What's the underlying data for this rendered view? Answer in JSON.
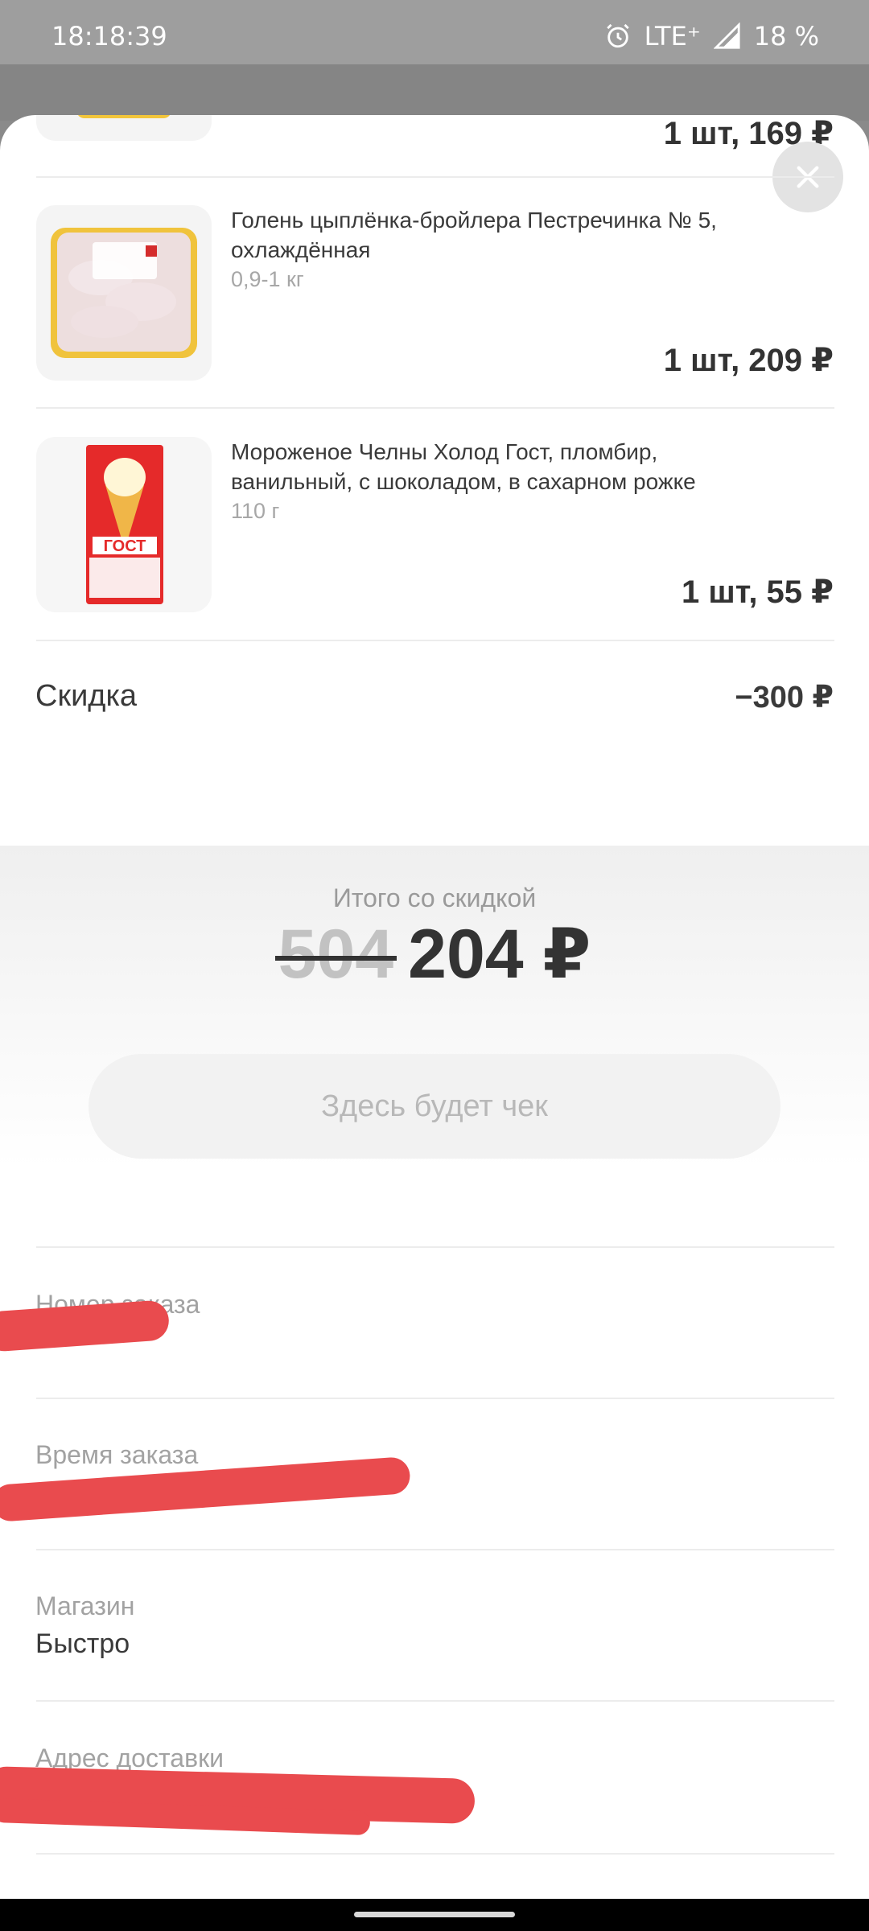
{
  "status_bar": {
    "time": "18:18:39",
    "network": "LTE⁺",
    "battery": "18 %",
    "icons": [
      "alarm-icon",
      "signal-icon"
    ]
  },
  "items": [
    {
      "price": "1 шт, 169 ₽"
    },
    {
      "name": "Голень цыплёнка-бройлера Пестречинка № 5, охлаждённая",
      "weight": "0,9-1 кг",
      "price": "1 шт, 209 ₽"
    },
    {
      "name": "Мороженое Челны Холод Гост, пломбир, ванильный, с шоколадом, в сахарном рожке",
      "weight": "110 г",
      "price": "1 шт, 55 ₽"
    }
  ],
  "discount": {
    "label": "Скидка",
    "value": "−300 ₽"
  },
  "total": {
    "label": "Итого со скидкой",
    "old_price": "504",
    "new_price": "204 ₽"
  },
  "receipt_button": "Здесь будет чек",
  "info": {
    "order_number_label": "Номер заказа",
    "order_time_label": "Время заказа",
    "store_label": "Магазин",
    "store_value": "Быстро",
    "address_label": "Адрес доставки"
  },
  "colors": {
    "accent_redaction": "#e94b4e",
    "text": "#333333",
    "muted": "#a2a2a2"
  }
}
